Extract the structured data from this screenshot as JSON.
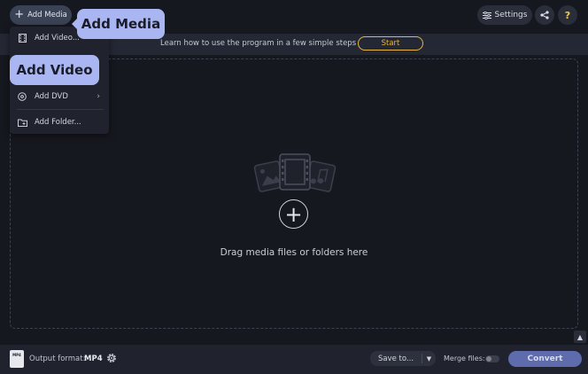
{
  "toolbar": {
    "add_media_label": "Add Media",
    "settings_label": "Settings"
  },
  "tooltips": {
    "add_media": "Add Media",
    "add_video": "Add Video"
  },
  "banner": {
    "text": "Learn how to use the program in a few simple steps",
    "start_label": "Start"
  },
  "menu": {
    "items": [
      {
        "label": "Add Video...",
        "icon": "film-icon"
      },
      {
        "label": "Add DVD",
        "icon": "disc-icon",
        "has_submenu": true
      },
      {
        "label": "Add Folder...",
        "icon": "folder-icon"
      }
    ]
  },
  "dropzone": {
    "text": "Drag media files or folders here"
  },
  "bottom": {
    "format_icon_text": "MP4",
    "output_label": "Output format:",
    "output_value": "MP4",
    "save_to_label": "Save to...",
    "merge_label": "Merge files:",
    "convert_label": "Convert"
  },
  "colors": {
    "tooltip": "#aab6f2",
    "start": "#e8b43a",
    "convert": "#5e6cae",
    "help": "#f2c94c"
  }
}
